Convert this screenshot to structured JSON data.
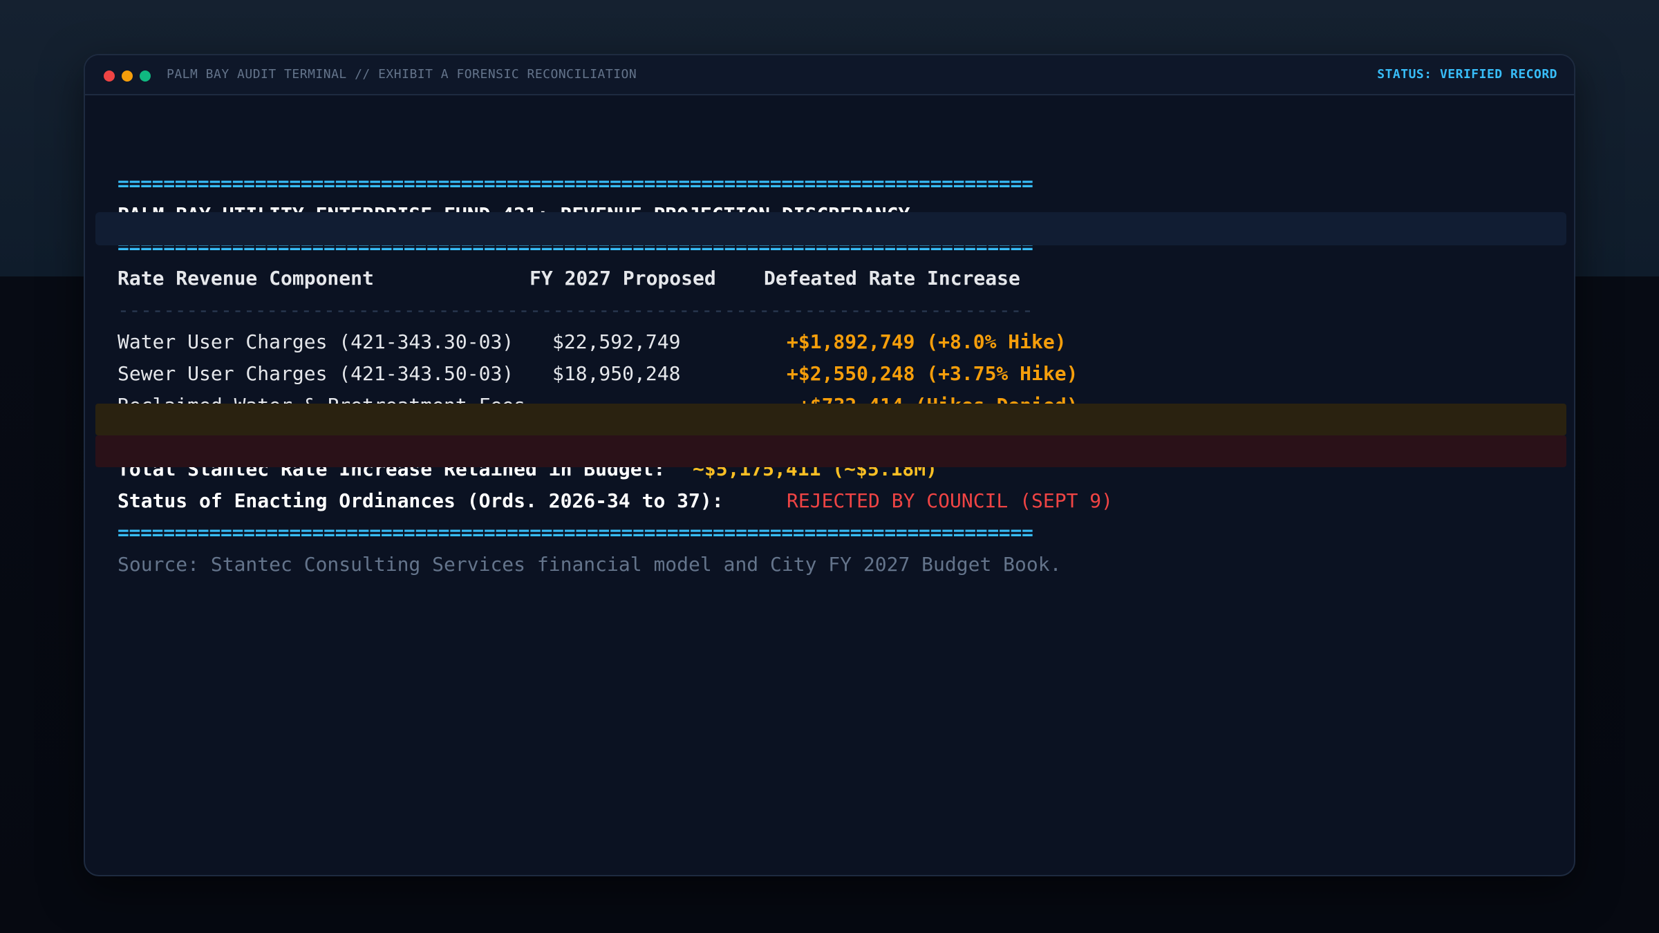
{
  "window": {
    "title": "PALM BAY AUDIT TERMINAL // EXHIBIT A FORENSIC RECONCILIATION",
    "status": "STATUS: VERIFIED RECORD"
  },
  "report": {
    "rule_double": "================================================================================",
    "rule_single": "--------------------------------------------------------------------------------",
    "headline": "PALM BAY UTILITY ENTERPRISE FUND 421: REVENUE PROJECTION DISCREPANCY",
    "columns": {
      "component": "Rate Revenue Component",
      "proposed": "FY 2027 Proposed",
      "increase": "Defeated Rate Increase"
    },
    "rows": [
      {
        "component": "Water User Charges (421-343.30-03)",
        "proposed": "$22,592,749",
        "increase": "+$1,892,749 (+8.0% Hike)"
      },
      {
        "component": "Sewer User Charges (421-343.50-03)",
        "proposed": "$18,950,248",
        "increase": "+$2,550,248 (+3.75% Hike)"
      },
      {
        "component": "Reclaimed Water & Pretreatment Fees",
        "proposed": "",
        "increase": "+$732,414 (Hikes Denied)"
      }
    ],
    "total": {
      "label": "Total Stantec Rate Increase Retained in Budget:",
      "value": "~$5,175,411 (~$5.18M)"
    },
    "ordinance_status": {
      "label": "Status of Enacting Ordinances (Ords. 2026-34 to 37):",
      "value": "REJECTED BY COUNCIL (SEPT 9)"
    },
    "source": "Source: Stantec Consulting Services financial model and City FY 2027 Budget Book."
  },
  "colors": {
    "accent": "#38bdf8",
    "highlight": "#f59e0b",
    "total": "#fbbf24",
    "rejected": "#ef4444"
  }
}
